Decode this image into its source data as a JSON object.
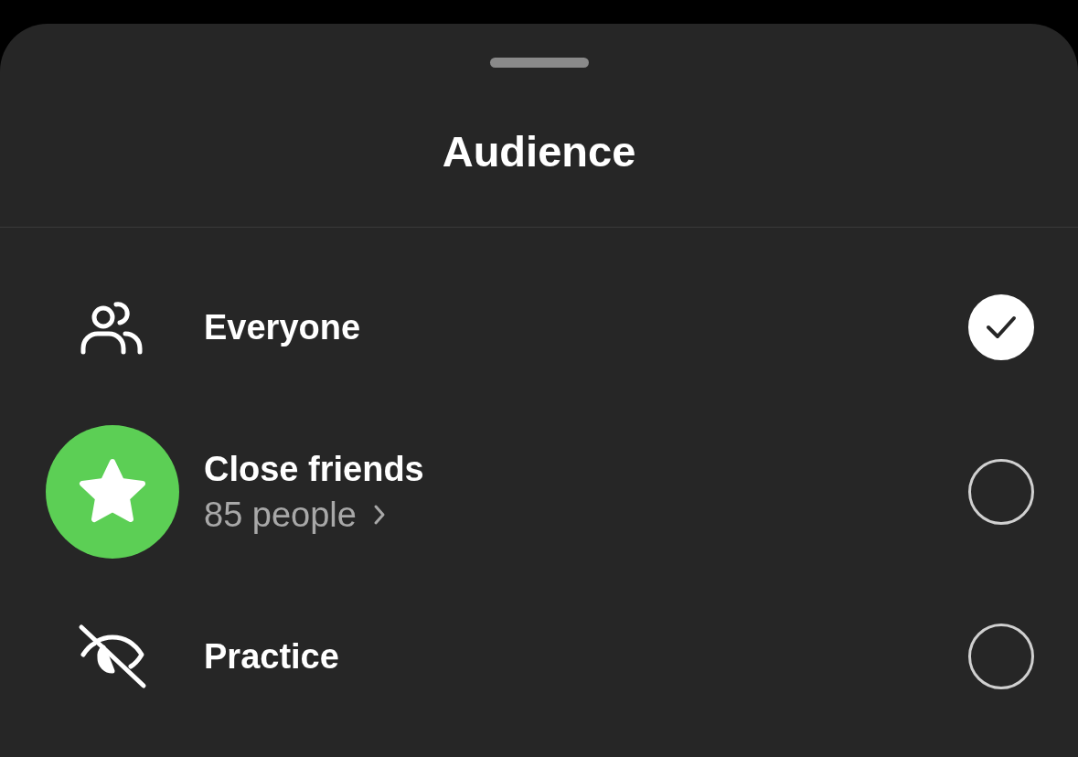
{
  "sheet": {
    "title": "Audience"
  },
  "options": [
    {
      "kind": "group",
      "label": "Everyone",
      "selected": true
    },
    {
      "kind": "star",
      "label": "Close friends",
      "sublabel": "85 people",
      "selected": false
    },
    {
      "kind": "hidden",
      "label": "Practice",
      "selected": false
    }
  ]
}
